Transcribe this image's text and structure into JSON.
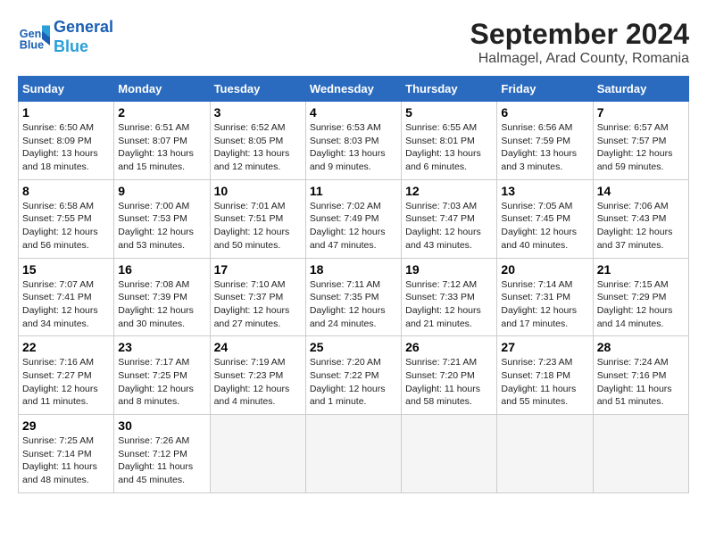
{
  "logo": {
    "line1": "General",
    "line2": "Blue"
  },
  "title": "September 2024",
  "subtitle": "Halmagel, Arad County, Romania",
  "days_of_week": [
    "Sunday",
    "Monday",
    "Tuesday",
    "Wednesday",
    "Thursday",
    "Friday",
    "Saturday"
  ],
  "weeks": [
    [
      {
        "day": 1,
        "info": "Sunrise: 6:50 AM\nSunset: 8:09 PM\nDaylight: 13 hours\nand 18 minutes."
      },
      {
        "day": 2,
        "info": "Sunrise: 6:51 AM\nSunset: 8:07 PM\nDaylight: 13 hours\nand 15 minutes."
      },
      {
        "day": 3,
        "info": "Sunrise: 6:52 AM\nSunset: 8:05 PM\nDaylight: 13 hours\nand 12 minutes."
      },
      {
        "day": 4,
        "info": "Sunrise: 6:53 AM\nSunset: 8:03 PM\nDaylight: 13 hours\nand 9 minutes."
      },
      {
        "day": 5,
        "info": "Sunrise: 6:55 AM\nSunset: 8:01 PM\nDaylight: 13 hours\nand 6 minutes."
      },
      {
        "day": 6,
        "info": "Sunrise: 6:56 AM\nSunset: 7:59 PM\nDaylight: 13 hours\nand 3 minutes."
      },
      {
        "day": 7,
        "info": "Sunrise: 6:57 AM\nSunset: 7:57 PM\nDaylight: 12 hours\nand 59 minutes."
      }
    ],
    [
      {
        "day": 8,
        "info": "Sunrise: 6:58 AM\nSunset: 7:55 PM\nDaylight: 12 hours\nand 56 minutes."
      },
      {
        "day": 9,
        "info": "Sunrise: 7:00 AM\nSunset: 7:53 PM\nDaylight: 12 hours\nand 53 minutes."
      },
      {
        "day": 10,
        "info": "Sunrise: 7:01 AM\nSunset: 7:51 PM\nDaylight: 12 hours\nand 50 minutes."
      },
      {
        "day": 11,
        "info": "Sunrise: 7:02 AM\nSunset: 7:49 PM\nDaylight: 12 hours\nand 47 minutes."
      },
      {
        "day": 12,
        "info": "Sunrise: 7:03 AM\nSunset: 7:47 PM\nDaylight: 12 hours\nand 43 minutes."
      },
      {
        "day": 13,
        "info": "Sunrise: 7:05 AM\nSunset: 7:45 PM\nDaylight: 12 hours\nand 40 minutes."
      },
      {
        "day": 14,
        "info": "Sunrise: 7:06 AM\nSunset: 7:43 PM\nDaylight: 12 hours\nand 37 minutes."
      }
    ],
    [
      {
        "day": 15,
        "info": "Sunrise: 7:07 AM\nSunset: 7:41 PM\nDaylight: 12 hours\nand 34 minutes."
      },
      {
        "day": 16,
        "info": "Sunrise: 7:08 AM\nSunset: 7:39 PM\nDaylight: 12 hours\nand 30 minutes."
      },
      {
        "day": 17,
        "info": "Sunrise: 7:10 AM\nSunset: 7:37 PM\nDaylight: 12 hours\nand 27 minutes."
      },
      {
        "day": 18,
        "info": "Sunrise: 7:11 AM\nSunset: 7:35 PM\nDaylight: 12 hours\nand 24 minutes."
      },
      {
        "day": 19,
        "info": "Sunrise: 7:12 AM\nSunset: 7:33 PM\nDaylight: 12 hours\nand 21 minutes."
      },
      {
        "day": 20,
        "info": "Sunrise: 7:14 AM\nSunset: 7:31 PM\nDaylight: 12 hours\nand 17 minutes."
      },
      {
        "day": 21,
        "info": "Sunrise: 7:15 AM\nSunset: 7:29 PM\nDaylight: 12 hours\nand 14 minutes."
      }
    ],
    [
      {
        "day": 22,
        "info": "Sunrise: 7:16 AM\nSunset: 7:27 PM\nDaylight: 12 hours\nand 11 minutes."
      },
      {
        "day": 23,
        "info": "Sunrise: 7:17 AM\nSunset: 7:25 PM\nDaylight: 12 hours\nand 8 minutes."
      },
      {
        "day": 24,
        "info": "Sunrise: 7:19 AM\nSunset: 7:23 PM\nDaylight: 12 hours\nand 4 minutes."
      },
      {
        "day": 25,
        "info": "Sunrise: 7:20 AM\nSunset: 7:22 PM\nDaylight: 12 hours\nand 1 minute."
      },
      {
        "day": 26,
        "info": "Sunrise: 7:21 AM\nSunset: 7:20 PM\nDaylight: 11 hours\nand 58 minutes."
      },
      {
        "day": 27,
        "info": "Sunrise: 7:23 AM\nSunset: 7:18 PM\nDaylight: 11 hours\nand 55 minutes."
      },
      {
        "day": 28,
        "info": "Sunrise: 7:24 AM\nSunset: 7:16 PM\nDaylight: 11 hours\nand 51 minutes."
      }
    ],
    [
      {
        "day": 29,
        "info": "Sunrise: 7:25 AM\nSunset: 7:14 PM\nDaylight: 11 hours\nand 48 minutes."
      },
      {
        "day": 30,
        "info": "Sunrise: 7:26 AM\nSunset: 7:12 PM\nDaylight: 11 hours\nand 45 minutes."
      },
      null,
      null,
      null,
      null,
      null
    ]
  ]
}
